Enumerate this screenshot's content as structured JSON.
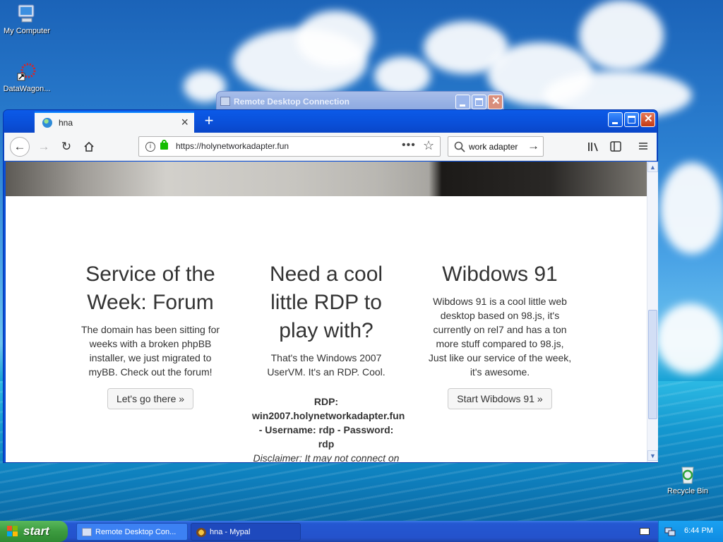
{
  "desktop": {
    "icons": [
      {
        "label": "My Computer",
        "icon": "computer-icon"
      },
      {
        "label": "DataWagon...",
        "icon": "datawagon-icon"
      },
      {
        "label": "Recycle Bin",
        "icon": "recycle-bin-icon"
      }
    ]
  },
  "rdc_window": {
    "title": "Remote Desktop Connection"
  },
  "browser": {
    "tab_title": "hna",
    "url": "https://holynetworkadapter.fun",
    "search_query": "work adapter",
    "content": {
      "col1": {
        "heading": "Service of the Week: Forum",
        "body": "The domain has been sitting for weeks with a broken phpBB installer, we just migrated to myBB. Check out the forum!",
        "button": "Let's go there »"
      },
      "col2": {
        "heading": "Need a cool little RDP to play with?",
        "body": "That's the Windows 2007 UserVM. It's an RDP. Cool.",
        "rdp_label": "RDP:",
        "rdp_host": "win2007.holynetworkadapter.fun",
        "rdp_creds": "- Username: rdp - Password: rdp",
        "disclaimer": "Disclaimer: It may not connect on"
      },
      "col3": {
        "heading": "Wibdows 91",
        "body": "Wibdows 91 is a cool little web desktop based on 98.js, it's currently on rel7 and has a ton more stuff compared to 98.js, Just like our service of the week, it's awesome.",
        "button": "Start Wibdows 91 »"
      }
    }
  },
  "taskbar": {
    "start_label": "start",
    "tasks": [
      {
        "label": "Remote Desktop Con...",
        "icon": "rdc-icon"
      },
      {
        "label": "hna - Mypal",
        "icon": "mypal-icon"
      }
    ],
    "clock": "6:44 PM"
  },
  "colors": {
    "xp_blue": "#0a4fd8",
    "start_green": "#3c9b3f",
    "tray_blue": "#0f8be2",
    "ssl_green": "#12bc00"
  }
}
